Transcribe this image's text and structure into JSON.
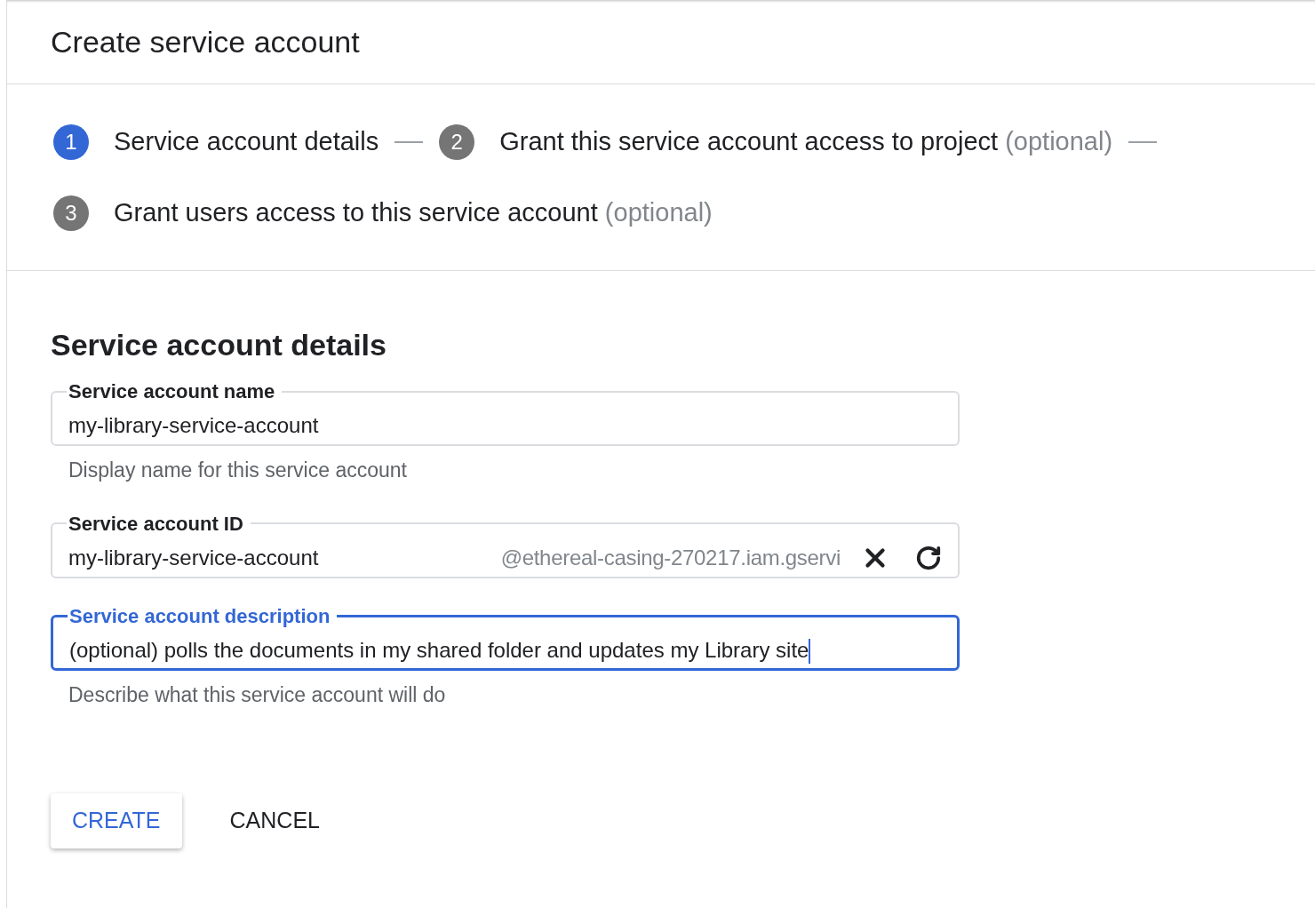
{
  "title": "Create service account",
  "steps": [
    {
      "number": "1",
      "label": "Service account details",
      "selected": true
    },
    {
      "number": "2",
      "label": "Grant this service account access to project",
      "optional": "(optional)",
      "selected": false
    },
    {
      "number": "3",
      "label": "Grant users access to this service account",
      "optional": "(optional)",
      "selected": false
    }
  ],
  "section_heading": "Service account details",
  "fields": [
    {
      "label": "Service account name",
      "value": "my-library-service-account",
      "hint": "Display name for this service account",
      "focused": false
    },
    {
      "label": "Service account ID",
      "value": "my-library-service-account",
      "suffix": "@ethereal-casing-270217.iam.gservi",
      "clearable": true,
      "refreshable": true,
      "focused": false
    },
    {
      "label": "Service account description",
      "value": "(optional) polls the documents in my shared folder and updates my Library site",
      "hint": "Describe what this service account will do",
      "focused": true
    }
  ],
  "buttons": [
    {
      "label": "CREATE",
      "kind": "raised"
    },
    {
      "label": "CANCEL",
      "kind": "flat"
    }
  ]
}
